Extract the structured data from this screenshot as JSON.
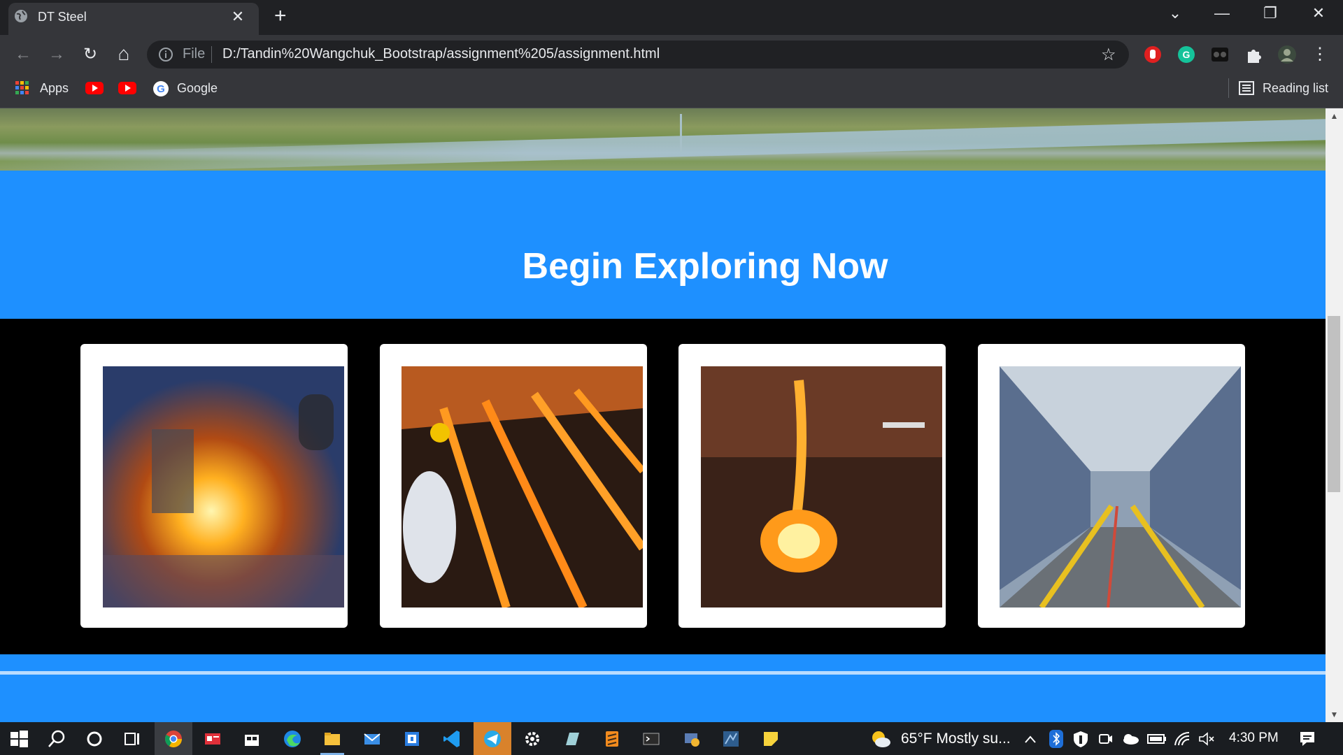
{
  "browser": {
    "tab_title": "DT Steel",
    "tab_close": "✕",
    "new_tab": "+",
    "window_controls": {
      "tabsearch": "⌄",
      "minimize": "—",
      "restore": "❐",
      "close": "✕"
    },
    "address": {
      "security_label": "File",
      "url": "D:/Tandin%20Wangchuk_Bootstrap/assignment%205/assignment.html"
    },
    "bookmarks": {
      "apps": "Apps",
      "google": "Google",
      "reading_list": "Reading list"
    },
    "nav": {
      "back": "←",
      "forward": "→",
      "reload": "↻",
      "home": "⌂",
      "star": "☆",
      "menu": "⋮"
    }
  },
  "page": {
    "heading": "Begin Exploring Now",
    "colors": {
      "blue": "#1e90ff",
      "black": "#000000"
    },
    "cards": [
      {
        "image": "steel-furnace-image"
      },
      {
        "image": "steel-worker-sparks-image"
      },
      {
        "image": "molten-steel-pour-image"
      },
      {
        "image": "steel-mill-hall-image"
      }
    ]
  },
  "taskbar": {
    "weather": "65°F  Mostly su...",
    "time": "4:30 PM"
  }
}
